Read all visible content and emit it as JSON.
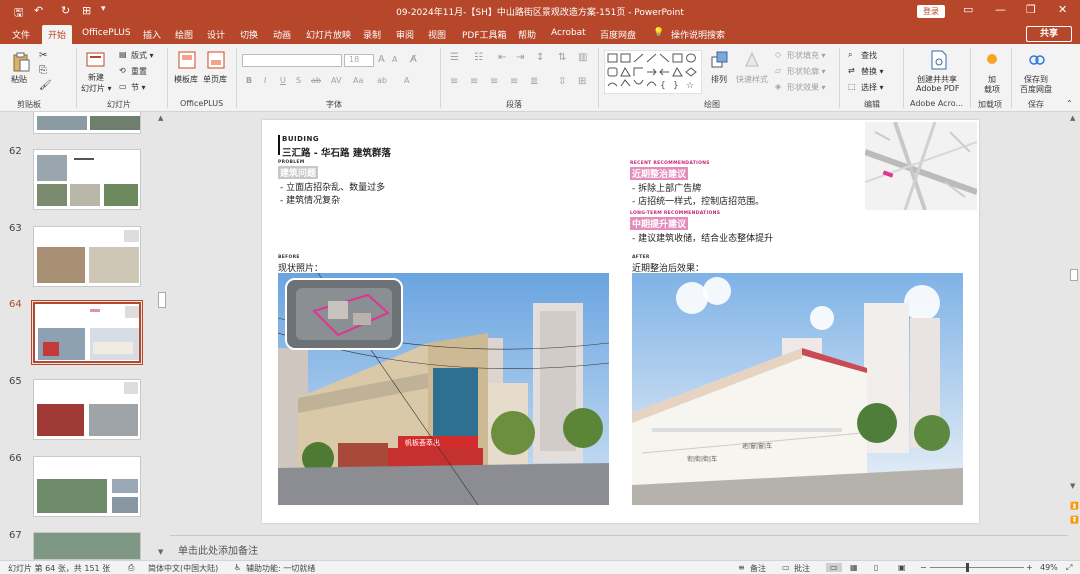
{
  "window": {
    "title": "09-2024年11月-【SH】中山路街区景观改造方案-151页  -  PowerPoint",
    "login_label": "登录",
    "share_label": "共享"
  },
  "tabs": [
    {
      "label": "文件"
    },
    {
      "label": "开始"
    },
    {
      "label": "OfficePLUS"
    },
    {
      "label": "插入"
    },
    {
      "label": "绘图"
    },
    {
      "label": "设计"
    },
    {
      "label": "切换"
    },
    {
      "label": "动画"
    },
    {
      "label": "幻灯片放映"
    },
    {
      "label": "录制"
    },
    {
      "label": "审阅"
    },
    {
      "label": "视图"
    },
    {
      "label": "PDF工具箱"
    },
    {
      "label": "帮助"
    },
    {
      "label": "Acrobat"
    },
    {
      "label": "百度网盘"
    },
    {
      "label": "操作说明搜索"
    }
  ],
  "ribbon": {
    "groups": {
      "clipboard": "剪贴板",
      "slides": "幻灯片",
      "officeplus": "OfficePLUS",
      "font": "字体",
      "paragraph": "段落",
      "drawing": "绘图",
      "editing": "编辑",
      "adobe": "Adobe Acro...",
      "addins": "加载项",
      "save": "保存"
    },
    "paste": "粘贴",
    "new_slide": "新建\n幻灯片",
    "new_slide_l1": "新建",
    "new_slide_l2": "幻灯片 ▾",
    "layout": "版式 ▾",
    "reset": "重置",
    "section": "节 ▾",
    "template_lib": "模板库",
    "single_page_lib": "单页库",
    "font_size": "18",
    "arrange": "排列",
    "quick_styles": "快速样式",
    "shape_fill": "形状填充 ▾",
    "shape_outline": "形状轮廓 ▾",
    "shape_effects": "形状效果 ▾",
    "find": "查找",
    "replace": "替换 ▾",
    "select": "选择 ▾",
    "adobe_l1": "创建并共享",
    "adobe_l2": "Adobe PDF",
    "addins_l1": "加",
    "addins_l2": "载项",
    "save_l1": "保存到",
    "save_l2": "百度网盘"
  },
  "thumbnails": [
    {
      "number": "62"
    },
    {
      "number": "63"
    },
    {
      "number": "64"
    },
    {
      "number": "65"
    },
    {
      "number": "66"
    },
    {
      "number": "67"
    }
  ],
  "slide": {
    "brand": "BUIDING",
    "heading": "三汇路 - 华石路  建筑群落",
    "problem_tag": "PROBLEM",
    "problem_title": "建筑问题",
    "problem_bullets": [
      "-  立面店招杂乱、数量过多",
      "-  建筑情况复杂"
    ],
    "recent_tag": "RECENT RECOMMENDATIONS",
    "recent_title": "近期整治建议",
    "recent_bullets": [
      "-  拆除上部广告牌",
      "-  店招统一样式，控制店招范围。"
    ],
    "long_tag": "LONG-TERM RECOMMENDATIONS",
    "long_title": "中期提升建议",
    "long_bullets": [
      "-  建议建筑收储，结合业态整体提升"
    ],
    "before_tag": "BEFORE",
    "before_caption": "现状照片：",
    "after_tag": "AFTER",
    "after_caption": "近期整治后效果：",
    "photo_signs": [
      "帆板荟萃出",
      "旺座"
    ],
    "render_signs": [
      "途|窗|窗|车",
      "衔|街|街|车"
    ]
  },
  "notes_placeholder": "单击此处添加备注",
  "status": {
    "slide_info": "幻灯片 第 64 张，共 151 张",
    "language": "简体中文(中国大陆)",
    "accessibility": "辅助功能: 一切就绪",
    "notes": "备注",
    "comments": "批注",
    "zoom": "49%"
  },
  "colors": {
    "accent": "#b7472a",
    "pink": "#e38dbd"
  }
}
